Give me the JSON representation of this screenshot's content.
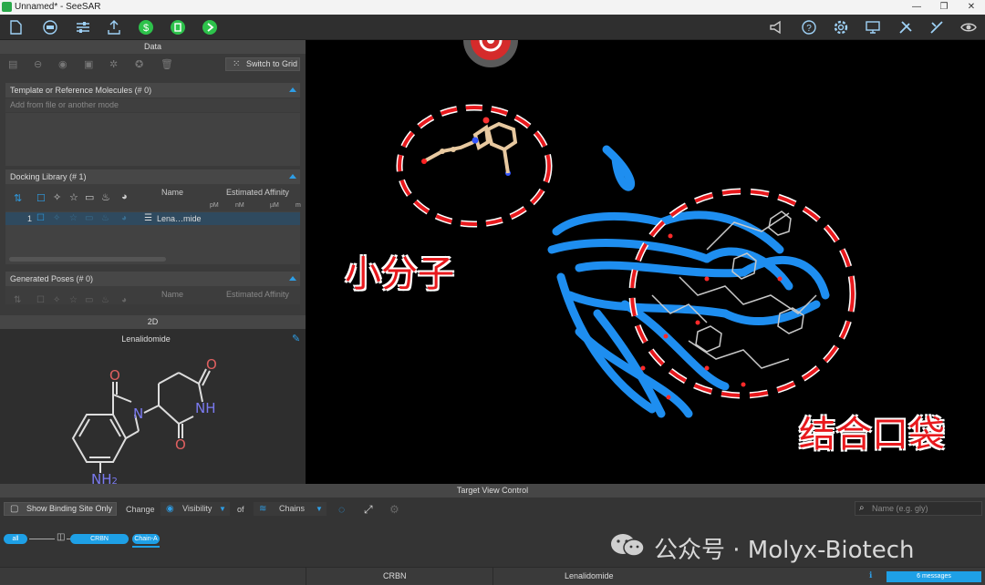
{
  "window": {
    "title": "Unnamed* - SeeSAR"
  },
  "toolbar": {
    "left_icons": [
      "file-icon",
      "project-icon",
      "sliders-icon",
      "upload-icon",
      "dollar-mode-icon",
      "protein-mode-icon",
      "next-mode-icon"
    ],
    "right_icons": [
      "announce-icon",
      "help-icon",
      "settings-icon",
      "monitor-icon",
      "tools-icon",
      "tools2-icon",
      "eye-icon"
    ]
  },
  "data_panel": {
    "header": "Data",
    "switch_to_grid": "Switch to Grid",
    "template_section": {
      "title": "Template or Reference Molecules (# 0)",
      "placeholder": "Add from file or another mode"
    },
    "docking_section": {
      "title": "Docking Library (# 1)",
      "col_name": "Name",
      "col_affinity": "Estimated Affinity",
      "units": [
        "pM",
        "nM",
        "µM",
        "m"
      ],
      "rows": [
        {
          "index": "1",
          "name": "Lena…mide"
        }
      ]
    },
    "poses_section": {
      "title": "Generated Poses (# 0)",
      "col_name": "Name",
      "col_affinity": "Estimated Affinity"
    }
  },
  "panel_2d": {
    "header": "2D",
    "molecule_name": "Lenalidomide",
    "atoms": {
      "o1": "O",
      "n1": "N",
      "o2": "O",
      "nh": "NH",
      "o3": "O",
      "nh2": "NH",
      "nh2_sub": "2"
    }
  },
  "viewer": {
    "annotation_small_molecule": "小分子",
    "annotation_pocket": "结合口袋",
    "colors": {
      "protein": "#1e8ef0",
      "annotation": "#e8191d"
    }
  },
  "target_view_control": {
    "header": "Target View Control",
    "show_binding_site_only": "Show Binding Site Only",
    "change": "Change",
    "visibility": "Visibility",
    "of": "of",
    "chains": "Chains",
    "search_placeholder": "Name (e.g. gly)",
    "tree": {
      "all": "all",
      "crbn": "CRBN",
      "chain": "Chain-A"
    },
    "status_crbn": "CRBN",
    "status_ligand": "Lenalidomide",
    "messages": "6 messages"
  },
  "watermark": "公众号 · Molyx-Biotech"
}
